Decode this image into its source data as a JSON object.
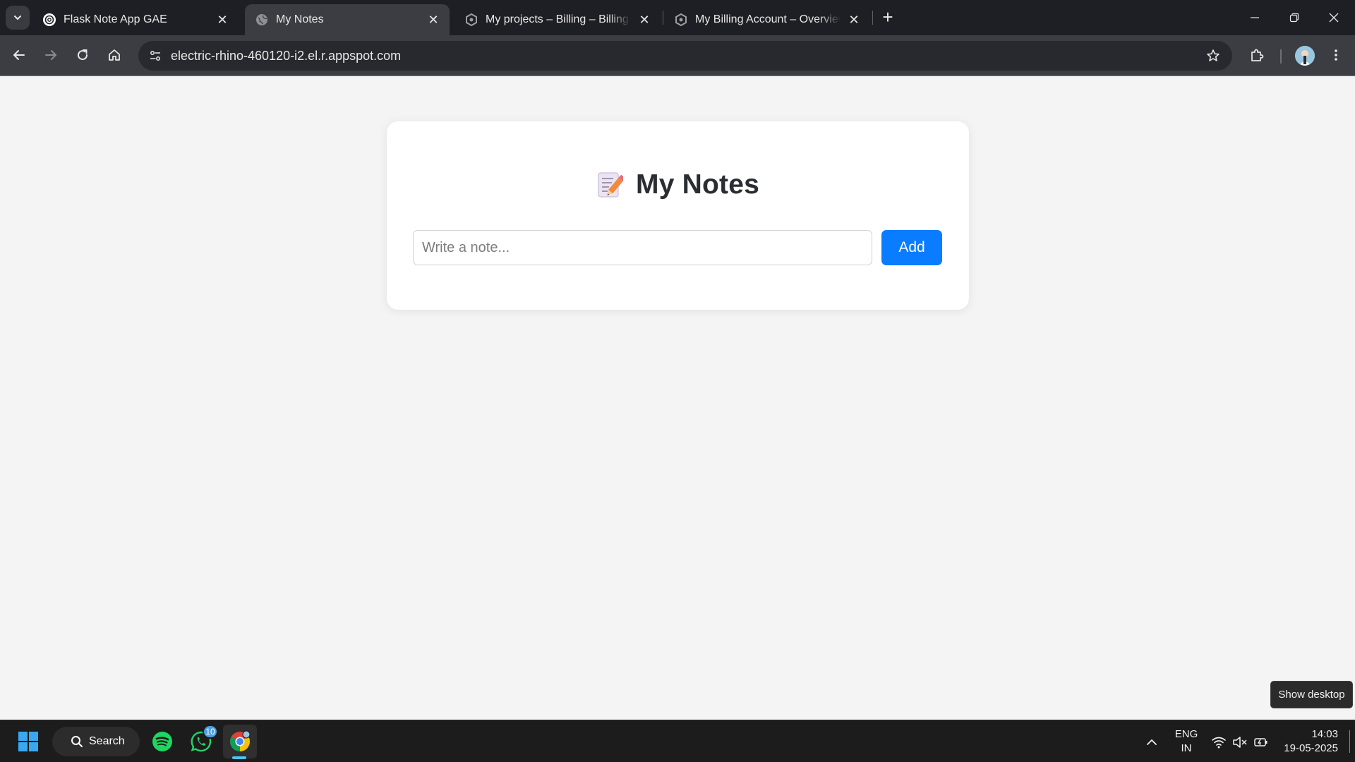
{
  "browser": {
    "tabs": [
      {
        "title": "Flask Note App GAE",
        "favicon": "openai-icon",
        "active": false
      },
      {
        "title": "My Notes",
        "favicon": "globe-icon",
        "active": true
      },
      {
        "title": "My projects – Billing – Billing – Google Cloud console",
        "favicon": "cloud-icon",
        "active": false
      },
      {
        "title": "My Billing Account – Overview – Billing",
        "favicon": "cloud-icon",
        "active": false
      }
    ],
    "new_tab_symbol": "+",
    "url": "electric-rhino-460120-i2.el.r.appspot.com"
  },
  "page": {
    "title_emoji": "memo-icon",
    "title": "My Notes",
    "note_input": {
      "placeholder": "Write a note...",
      "value": ""
    },
    "add_button_label": "Add",
    "accent_color": "#0a7cff"
  },
  "tooltip": {
    "text": "Show desktop"
  },
  "taskbar": {
    "search_label": "Search",
    "whatsapp_badge": "10",
    "language": {
      "line1": "ENG",
      "line2": "IN"
    },
    "clock": {
      "time": "14:03",
      "date": "19-05-2025"
    }
  }
}
